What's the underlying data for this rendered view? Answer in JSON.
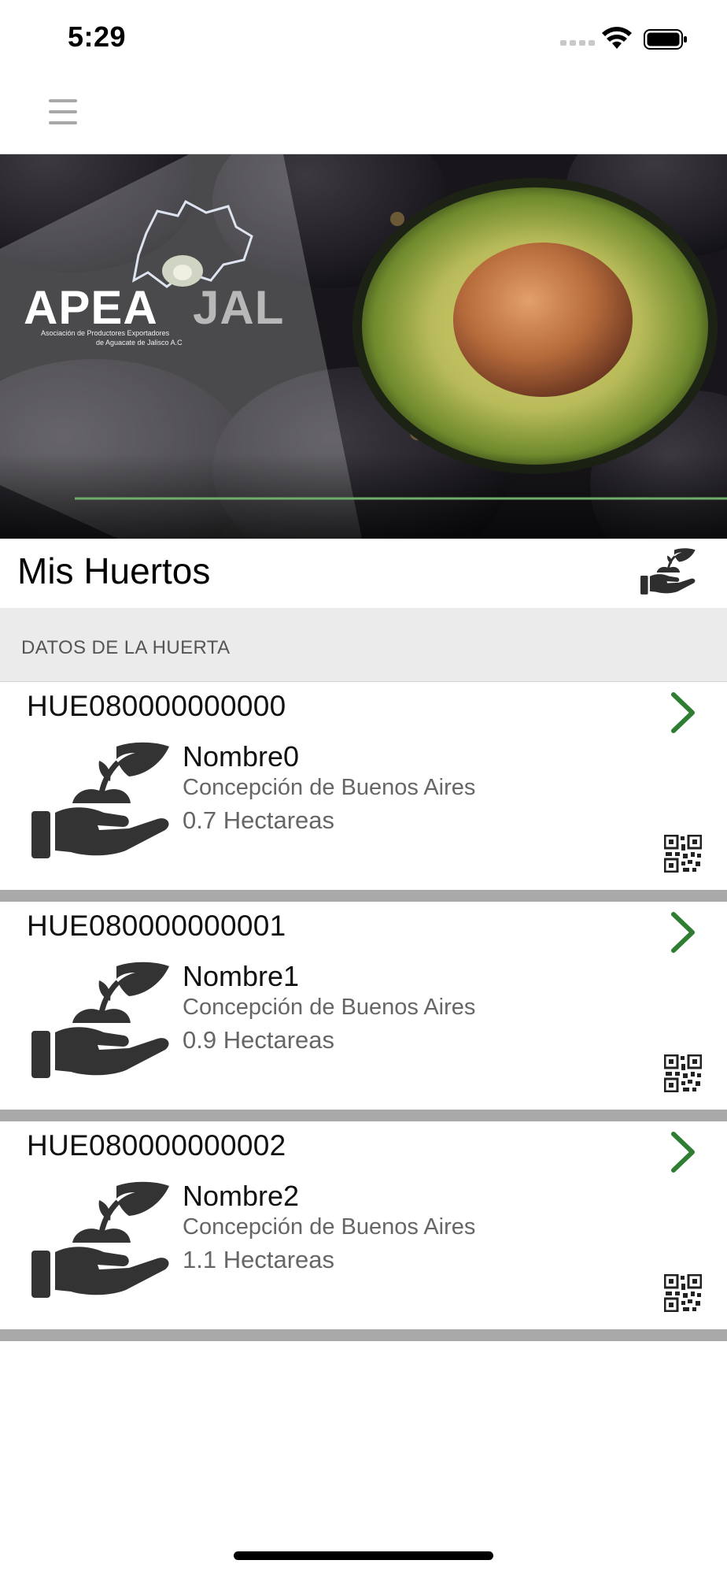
{
  "status_bar": {
    "time": "5:29"
  },
  "nav": {
    "menu_icon": "hamburger-menu-icon"
  },
  "banner": {
    "logo_main": "APEA",
    "logo_accent": "JAL",
    "logo_subtitle_line1": "Asociación de Productores Exportadores",
    "logo_subtitle_line2": "de Aguacate de Jalisco A.C"
  },
  "section": {
    "title": "Mis Huertos",
    "subheader": "DATOS DE LA HUERTA",
    "header_icon": "plant-in-hand-icon"
  },
  "orchards": [
    {
      "code": "HUE080000000000",
      "name": "Nombre0",
      "location": "Concepción de Buenos Aires",
      "area": "0.7 Hectareas"
    },
    {
      "code": "HUE080000000001",
      "name": "Nombre1",
      "location": "Concepción de Buenos Aires",
      "area": "0.9 Hectareas"
    },
    {
      "code": "HUE080000000002",
      "name": "Nombre2",
      "location": "Concepción de Buenos Aires",
      "area": "1.1 Hectareas"
    }
  ],
  "colors": {
    "accent_green": "#2e7d32",
    "separator": "#a9a9a9",
    "subheader_bg": "#ebebeb",
    "icon_dark": "#333333"
  }
}
